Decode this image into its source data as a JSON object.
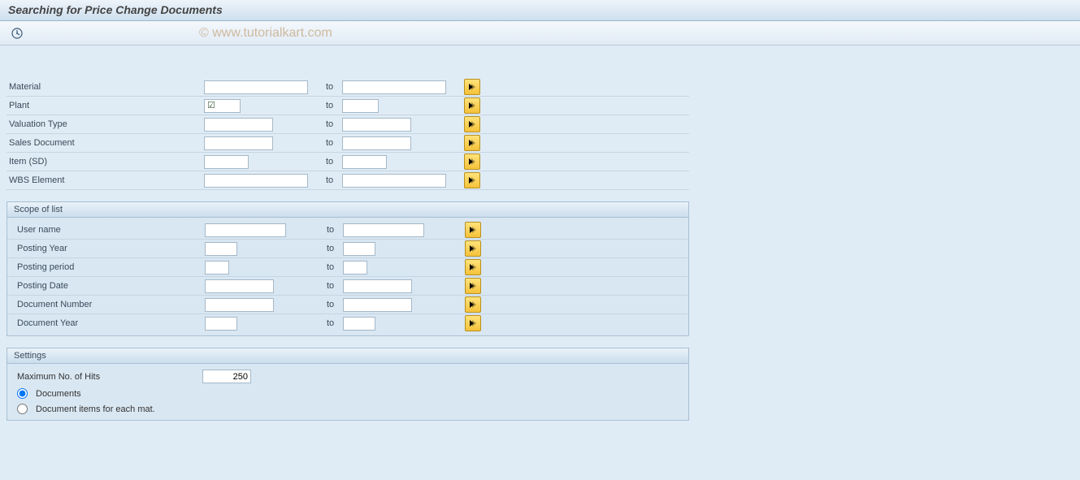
{
  "title": "Searching for Price Change Documents",
  "watermark": "© www.tutorialkart.com",
  "labels": {
    "to": "to"
  },
  "selection": {
    "material": {
      "label": "Material",
      "low": "",
      "high": ""
    },
    "plant": {
      "label": "Plant",
      "low": "",
      "high": "",
      "checked": true
    },
    "valtype": {
      "label": "Valuation Type",
      "low": "",
      "high": ""
    },
    "salesdoc": {
      "label": "Sales Document",
      "low": "",
      "high": ""
    },
    "item": {
      "label": "Item (SD)",
      "low": "",
      "high": ""
    },
    "wbs": {
      "label": "WBS Element",
      "low": "",
      "high": ""
    }
  },
  "scope": {
    "title": "Scope of list",
    "user": {
      "label": "User name",
      "low": "",
      "high": ""
    },
    "year": {
      "label": "Posting Year",
      "low": "",
      "high": ""
    },
    "period": {
      "label": "Posting period",
      "low": "",
      "high": ""
    },
    "date": {
      "label": "Posting Date",
      "low": "",
      "high": ""
    },
    "docnum": {
      "label": "Document Number",
      "low": "",
      "high": ""
    },
    "docyear": {
      "label": "Document Year",
      "low": "",
      "high": ""
    }
  },
  "settings": {
    "title": "Settings",
    "maxhits_label": "Maximum No. of Hits",
    "maxhits_value": "250",
    "radio_docs": "Documents",
    "radio_items": "Document items for each mat."
  }
}
